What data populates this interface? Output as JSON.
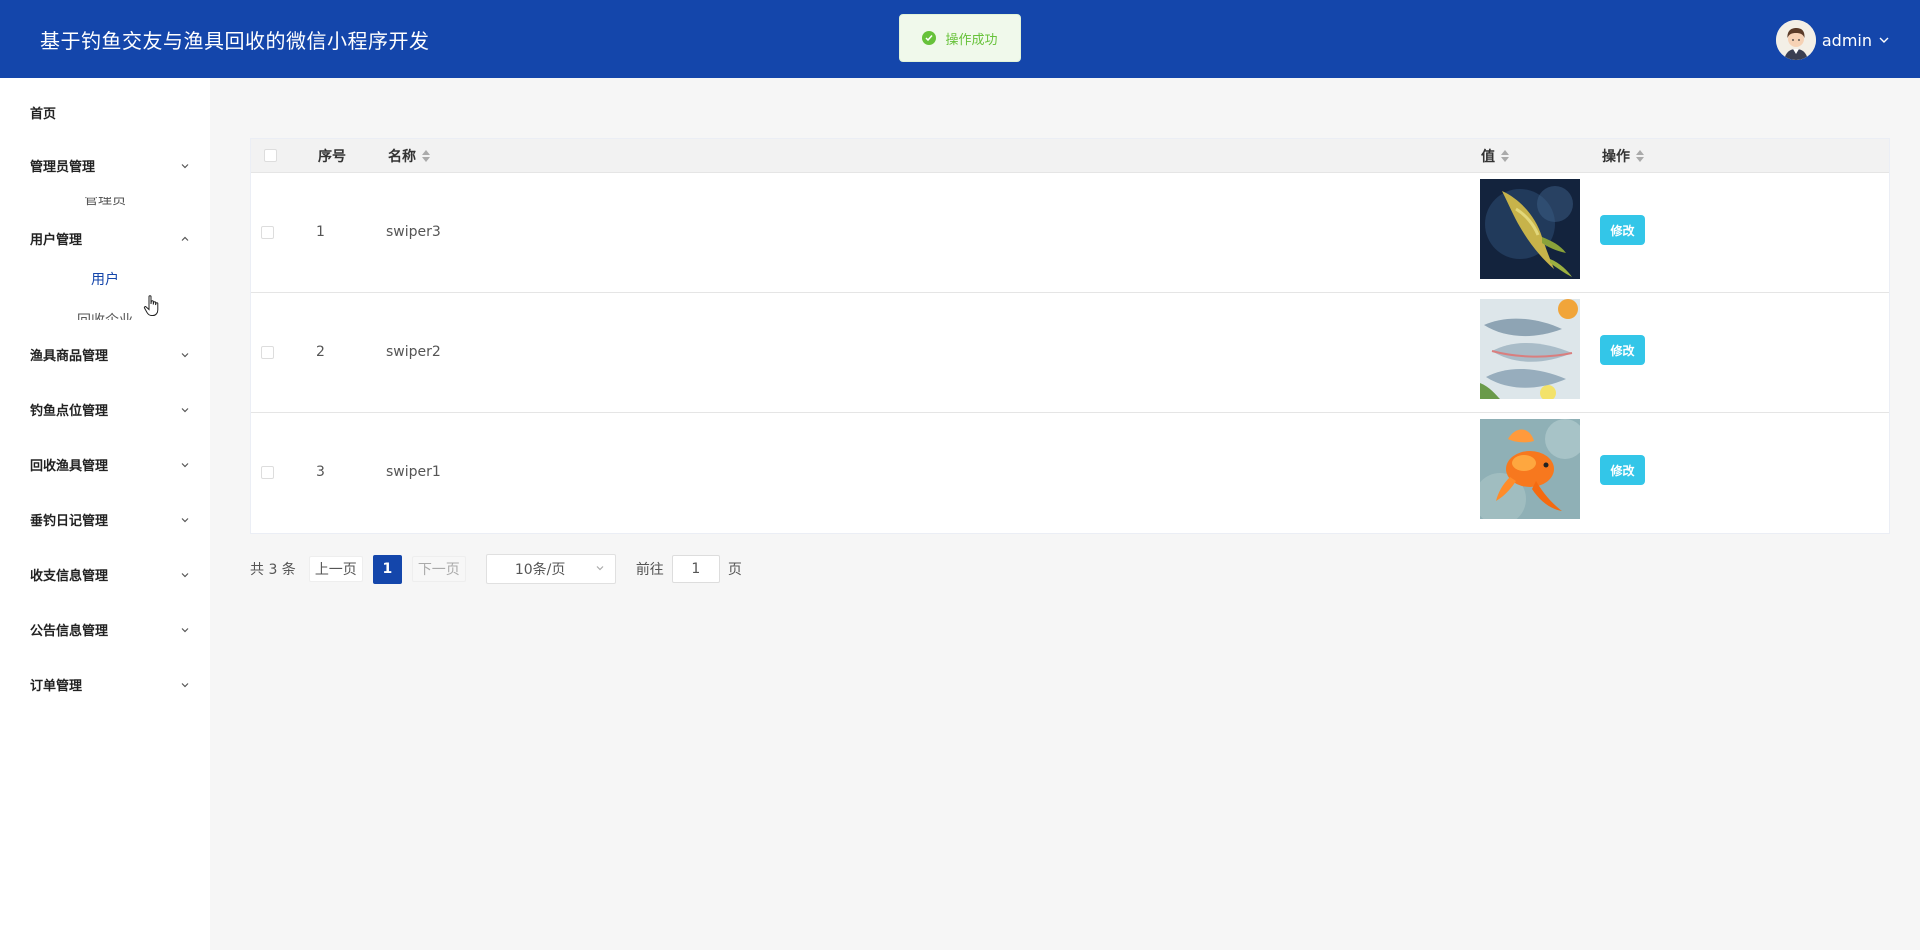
{
  "header": {
    "title": "基于钓鱼交友与渔具回收的微信小程序开发",
    "toast": "操作成功",
    "username": "admin",
    "brand_color": "#1446ab"
  },
  "sidebar": {
    "home": "首页",
    "admin_group": {
      "label": "管理员管理",
      "peek": "管理员"
    },
    "user_group": {
      "label": "用户管理",
      "items": [
        "用户",
        "回收企业"
      ]
    },
    "groups": [
      "渔具商品管理",
      "钓鱼点位管理",
      "回收渔具管理",
      "垂钓日记管理",
      "收支信息管理",
      "公告信息管理",
      "订单管理"
    ]
  },
  "table": {
    "headers": {
      "index": "序号",
      "name": "名称",
      "value": "值",
      "action": "操作"
    },
    "rows": [
      {
        "index": "1",
        "name": "swiper3",
        "image": "fish-image",
        "action": "修改"
      },
      {
        "index": "2",
        "name": "swiper2",
        "image": "fresh-fish-image",
        "action": "修改"
      },
      {
        "index": "3",
        "name": "swiper1",
        "image": "goldfish-image",
        "action": "修改"
      }
    ]
  },
  "pagination": {
    "total": "共 3 条",
    "prev": "上一页",
    "current": "1",
    "next": "下一页",
    "page_size": "10条/页",
    "goto_label": "前往",
    "goto_value": "1",
    "page_suffix": "页"
  }
}
